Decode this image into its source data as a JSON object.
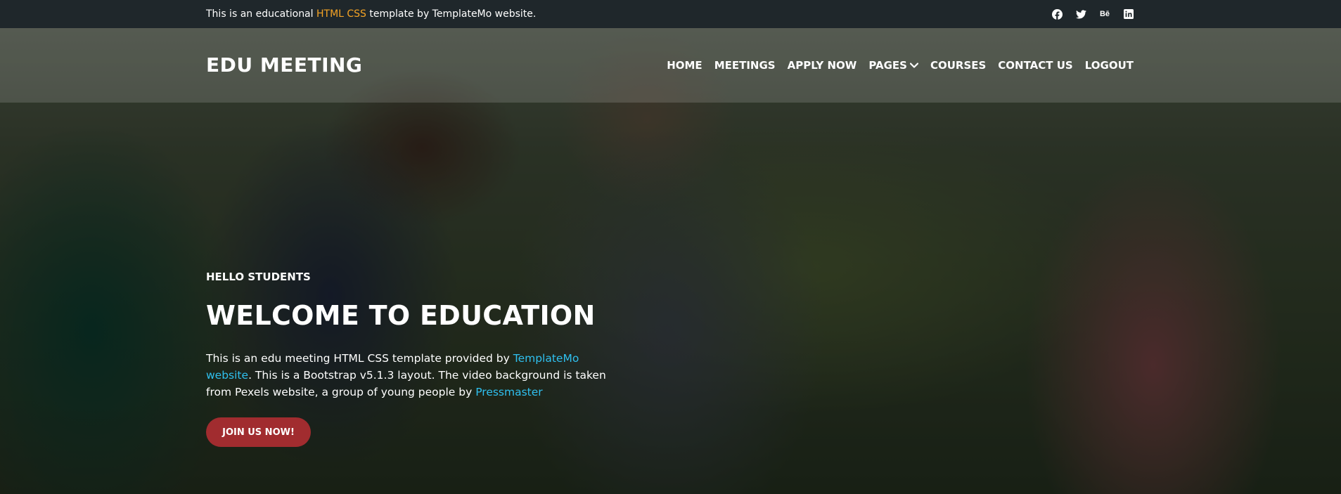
{
  "topbar": {
    "text_before": "This is an educational ",
    "text_link": "HTML CSS",
    "text_after": " template by TemplateMo website.",
    "social": [
      {
        "icon": "facebook-icon"
      },
      {
        "icon": "twitter-icon"
      },
      {
        "icon": "behance-icon",
        "label": "Bē"
      },
      {
        "icon": "linkedin-icon"
      }
    ]
  },
  "header": {
    "logo": "EDU MEETING",
    "nav": [
      {
        "label": "HOME"
      },
      {
        "label": "MEETINGS"
      },
      {
        "label": "APPLY NOW"
      },
      {
        "label": "PAGES"
      },
      {
        "label": "COURSES"
      },
      {
        "label": "CONTACT US"
      },
      {
        "label": "LOGOUT"
      }
    ]
  },
  "hero": {
    "kicker": "HELLO STUDENTS",
    "title": "WELCOME TO EDUCATION",
    "desc_1": "This is an edu meeting HTML CSS template provided by ",
    "desc_link_1": "TemplateMo website",
    "desc_2": ". This is a Bootstrap v5.1.3 layout. The video background is taken from Pexels website, a group of young people by ",
    "desc_link_2": "Pressmaster",
    "cta": "JOIN US NOW!"
  },
  "colors": {
    "topbar_bg": "#1f272b",
    "accent_orange": "#f5a425",
    "link_blue": "#2fc0ef",
    "button_red": "#a12c2f"
  }
}
